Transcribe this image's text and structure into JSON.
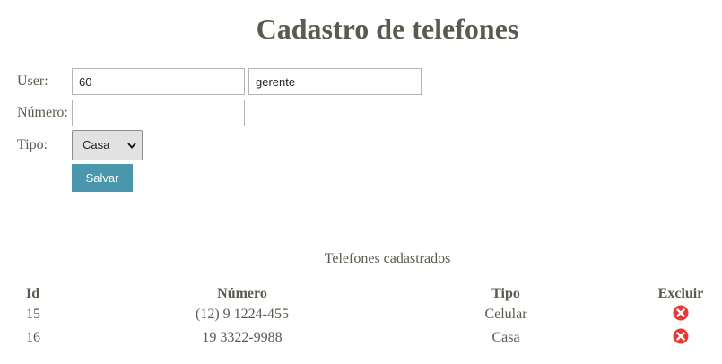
{
  "header": {
    "title": "Cadastro de telefones"
  },
  "form": {
    "user_label": "User:",
    "user_id_value": "60",
    "user_name_value": "gerente",
    "numero_label": "Número:",
    "numero_value": "",
    "tipo_label": "Tipo:",
    "tipo_selected": "Casa",
    "save_label": "Salvar"
  },
  "list": {
    "caption": "Telefones cadastrados",
    "columns": {
      "id": "Id",
      "numero": "Número",
      "tipo": "Tipo",
      "excluir": "Excluir"
    },
    "rows": [
      {
        "id": "15",
        "numero": "(12) 9 1224-455",
        "tipo": "Celular",
        "delete_icon": "delete-icon"
      },
      {
        "id": "16",
        "numero": "19 3322-9988",
        "tipo": "Casa",
        "delete_icon": "delete-icon"
      }
    ]
  },
  "colors": {
    "text": "#5a5a4e",
    "button": "#4a97ad",
    "delete": "#e53935"
  }
}
